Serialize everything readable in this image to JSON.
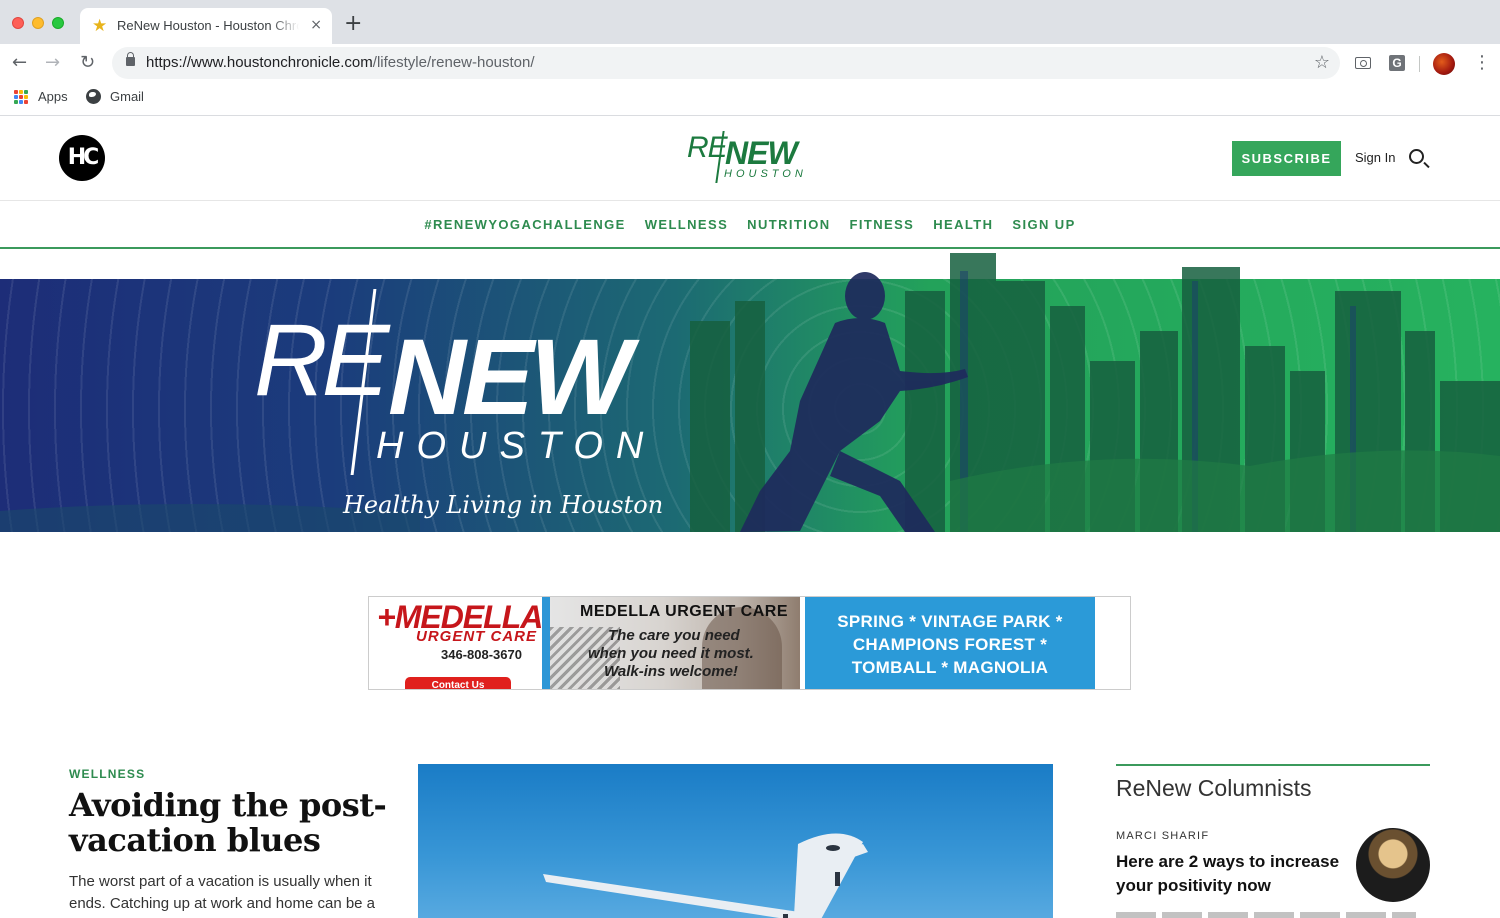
{
  "browser": {
    "tab_title": "ReNew Houston - Houston Chronicle",
    "tab_close": "×",
    "new_tab": "+",
    "url_host": "https://www.houstonchronicle.com",
    "url_path": "/lifestyle/renew-houston/",
    "bookmarks": [
      {
        "label": "Apps",
        "icon": "apps-grid-icon"
      },
      {
        "label": "Gmail",
        "icon": "globe-icon"
      }
    ],
    "extension_letter": "G"
  },
  "site": {
    "logo_text": "HC",
    "brand": {
      "re": "RE",
      "new": "NEW",
      "houston": "HOUSTON"
    },
    "subscribe": "SUBSCRIBE",
    "sign_in": "Sign In",
    "accent": "#35a65b"
  },
  "nav": [
    "#RENEWYOGACHALLENGE",
    "WELLNESS",
    "NUTRITION",
    "FITNESS",
    "HEALTH",
    "SIGN UP"
  ],
  "hero": {
    "re": "RE",
    "new": "NEW",
    "houston": "HOUSTON",
    "tagline": "Healthy Living in Houston"
  },
  "ad": {
    "brand": "MEDELLA",
    "brand_sub": "URGENT CARE",
    "phone": "346-808-3670",
    "contact": "Contact Us",
    "mid_title": "MEDELLA URGENT CARE",
    "mid_lines": [
      "The care you need",
      "when you need it most.",
      "Walk-ins welcome!"
    ],
    "locations": [
      "SPRING * VINTAGE PARK *",
      "CHAMPIONS FOREST *",
      "TOMBALL * MAGNOLIA"
    ]
  },
  "article": {
    "category": "WELLNESS",
    "title": "Avoiding the post-vacation blues",
    "description": "The worst part of a vacation is usually when it ends. Catching up at work and home can be a"
  },
  "columnists": {
    "heading": "ReNew Columnists",
    "author": "MARCI SHARIF",
    "title": "Here are 2 ways to increase your positivity now"
  }
}
